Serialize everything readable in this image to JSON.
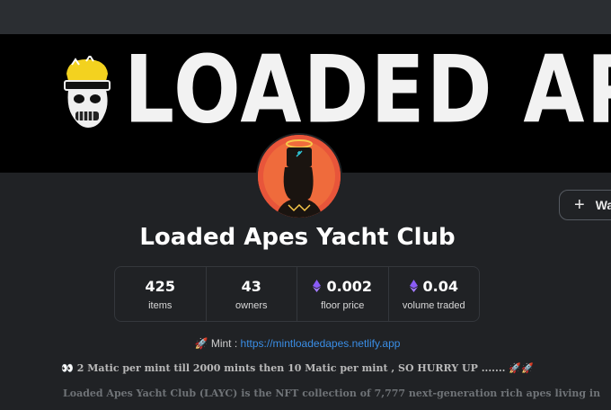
{
  "banner": {
    "text": "LOADED APES"
  },
  "collection": {
    "title": "Loaded Apes Yacht Club",
    "watch_label": "Wa"
  },
  "stats": [
    {
      "value": "425",
      "label": "items",
      "eth": false
    },
    {
      "value": "43",
      "label": "owners",
      "eth": false
    },
    {
      "value": "0.002",
      "label": "floor price",
      "eth": true
    },
    {
      "value": "0.04",
      "label": "volume traded",
      "eth": true
    }
  ],
  "description": {
    "mint_emoji": "🚀",
    "mint_prefix": " Mint : ",
    "mint_link": "https://mintloadedapes.netlify.app",
    "promo": "👀 2 Matic per mint till 2000 mints then 10 Matic per mint , SO HURRY UP ....... 🚀🚀",
    "intro": "Loaded Apes Yacht Club (LAYC) is the NFT collection of 7,777 next-generation rich apes living in"
  },
  "colors": {
    "background": "#202225",
    "link": "#3a8ee6",
    "eth": "#8a5cf6",
    "avatar_bg": "#e8553a"
  }
}
